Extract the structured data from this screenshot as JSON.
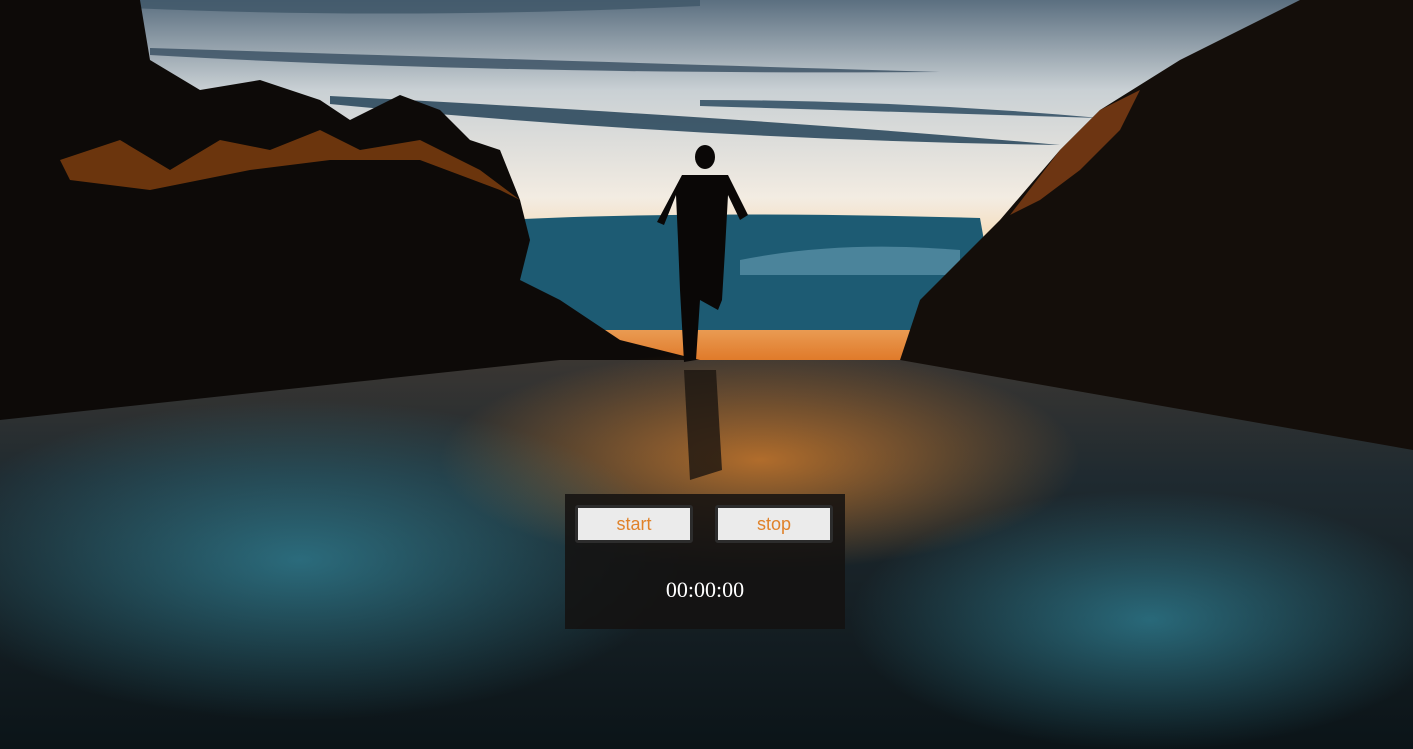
{
  "controls": {
    "start_label": "start",
    "stop_label": "stop"
  },
  "timer": {
    "display": "00:00:00"
  },
  "colors": {
    "accent": "#e0822a",
    "panel": "#141210",
    "button_bg": "#ebebeb"
  }
}
